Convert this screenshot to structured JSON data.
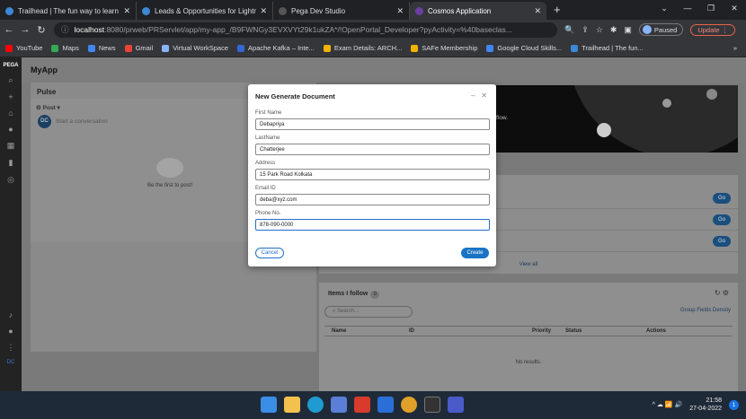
{
  "browser": {
    "tabs": [
      {
        "title": "Trailhead | The fun way to learn",
        "color": "#3a88d6"
      },
      {
        "title": "Leads & Opportunities for Lightn",
        "color": "#3a88d6"
      },
      {
        "title": "Pega Dev Studio",
        "color": "#555555"
      },
      {
        "title": "Cosmos Application",
        "color": "#6a3fa0"
      }
    ],
    "url_host": "localhost",
    "url_rest": ":8080/prweb/PRServlet/app/my-app_/B9FWNGy3EVXVYt29k1ukZA*/!OpenPortal_Developer?pyActivity=%40baseclas...",
    "paused_label": "Paused",
    "update_label": "Update"
  },
  "bookmarks": [
    {
      "label": "YouTube",
      "color": "#ff0000"
    },
    {
      "label": "Maps",
      "color": "#34a853"
    },
    {
      "label": "News",
      "color": "#4285f4"
    },
    {
      "label": "Gmail",
      "color": "#ea4335"
    },
    {
      "label": "Virtual WorkSpace",
      "color": "#8ab4f8"
    },
    {
      "label": "Apache Kafka – Inte...",
      "color": "#3367d6"
    },
    {
      "label": "Exam Details: ARCH...",
      "color": "#f0b400"
    },
    {
      "label": "SAFe Membership",
      "color": "#f0b400"
    },
    {
      "label": "Google Cloud Skills...",
      "color": "#4285f4"
    },
    {
      "label": "Trailhead | The fun...",
      "color": "#3a88d6"
    }
  ],
  "app": {
    "rail_logo": "PEGA",
    "rail_bottom": "DC",
    "title": "MyApp",
    "pulse_title": "Pulse",
    "post_label": "Post",
    "avatar": "DC",
    "start_conversation": "Start a conversation",
    "first_post": "Be the first to post!",
    "hero_text": "flow.",
    "view_all": "View all",
    "go_label": "Go",
    "items_follow": "Items I follow",
    "items_count": "0",
    "search_placeholder": "Search...",
    "opts": "Group  Fields  Density",
    "columns": [
      "Name",
      "ID",
      "Priority",
      "Status",
      "Actions"
    ],
    "no_results": "No results."
  },
  "modal": {
    "title": "New Generate Document",
    "fields": [
      {
        "label": "First Name",
        "value": "Debapriya"
      },
      {
        "label": "LastName",
        "value": "Chatterjee"
      },
      {
        "label": "Address",
        "value": "15 Park Road Kolkata"
      },
      {
        "label": "Email ID",
        "value": "deba@xyz.com"
      },
      {
        "label": "Phone No.",
        "value": "878-090-0000"
      }
    ],
    "cancel": "Cancel",
    "create": "Create"
  },
  "taskbar": {
    "time": "21:58",
    "date": "27-04-2022",
    "notif": "1"
  }
}
